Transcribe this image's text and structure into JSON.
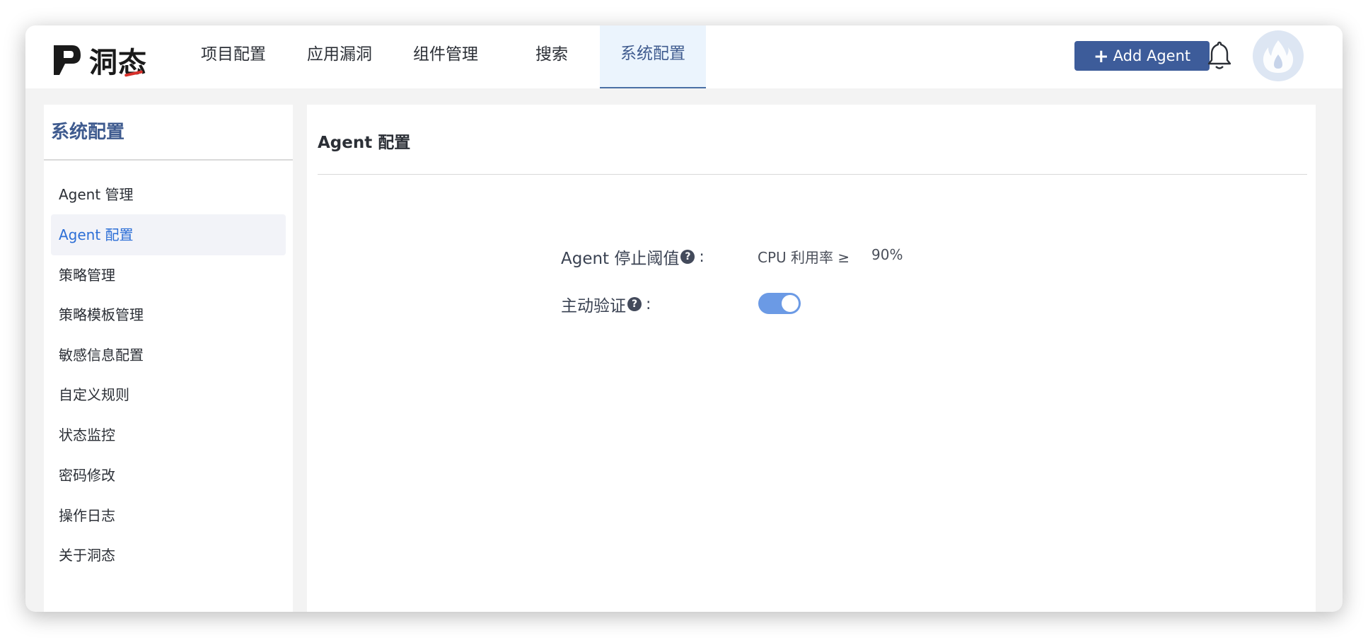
{
  "brand": {
    "name": "洞态"
  },
  "nav": {
    "tabs": [
      {
        "label": "项目配置"
      },
      {
        "label": "应用漏洞"
      },
      {
        "label": "组件管理"
      },
      {
        "label": "搜索"
      },
      {
        "label": "系统配置",
        "active": true
      }
    ]
  },
  "header": {
    "add_agent_label": "Add Agent",
    "add_agent_icon": "plus-icon",
    "notification_icon": "bell-icon",
    "avatar_icon": "flame-icon"
  },
  "sidebar": {
    "title": "系统配置",
    "items": [
      {
        "label": "Agent 管理"
      },
      {
        "label": "Agent 配置",
        "active": true
      },
      {
        "label": "策略管理"
      },
      {
        "label": "策略模板管理"
      },
      {
        "label": "敏感信息配置"
      },
      {
        "label": "自定义规则"
      },
      {
        "label": "状态监控"
      },
      {
        "label": "密码修改"
      },
      {
        "label": "操作日志"
      },
      {
        "label": "关于洞态"
      }
    ]
  },
  "main": {
    "title": "Agent 配置",
    "threshold": {
      "label": "Agent 停止阈值",
      "help_icon": "question-icon",
      "value_text": "CPU 利用率 ≥",
      "value": "90%"
    },
    "active_verify": {
      "label": "主动验证",
      "help_icon": "question-icon",
      "enabled": true
    }
  },
  "colors": {
    "primary": "#3d5c9a",
    "active_link": "#2d6fd6",
    "toggle_on": "#6b9ae5",
    "logo_accent": "#d9302a"
  }
}
